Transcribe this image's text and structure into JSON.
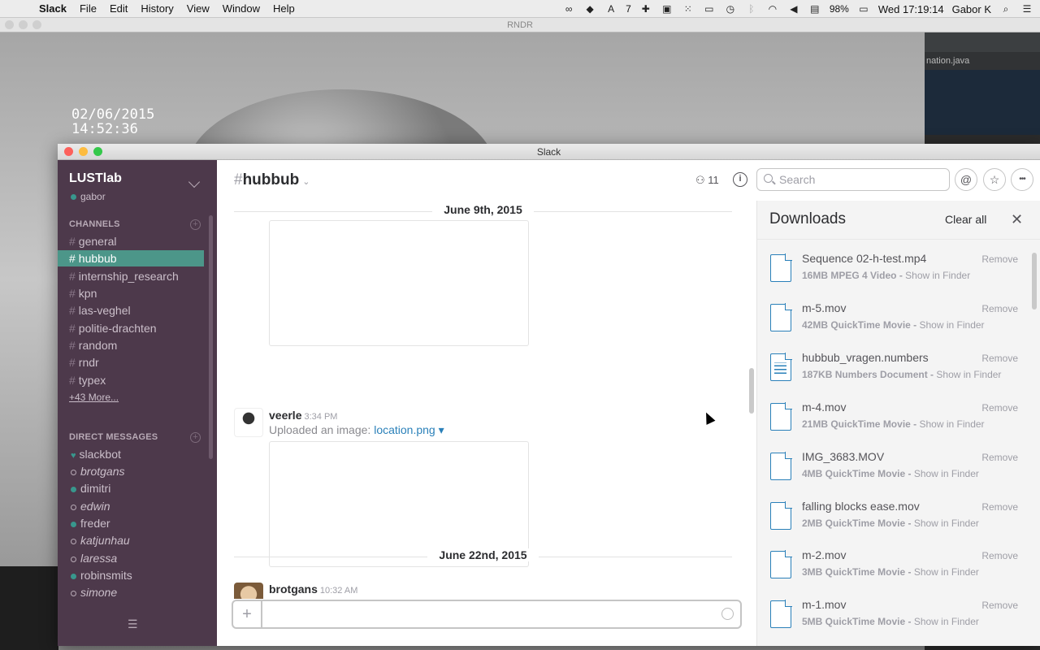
{
  "menubar": {
    "app": "Slack",
    "menus": [
      "File",
      "Edit",
      "History",
      "View",
      "Window",
      "Help"
    ],
    "status": {
      "adobe_count": "7",
      "battery": "98%",
      "clock": "Wed 17:19:14",
      "user": "Gabor K"
    }
  },
  "background_window": {
    "title": "RNDR",
    "overlay_date": "02/06/2015",
    "overlay_time": "14:52:36",
    "ide_tab": "nation.java"
  },
  "window": {
    "title": "Slack"
  },
  "sidebar": {
    "team": "LUSTlab",
    "user": "gabor",
    "channels_header": "CHANNELS",
    "channels": [
      "general",
      "hubbub",
      "internship_research",
      "kpn",
      "las-veghel",
      "politie-drachten",
      "random",
      "rndr",
      "typex"
    ],
    "active_channel": "hubbub",
    "more": "+43 More...",
    "dm_header": "DIRECT MESSAGES",
    "dms": [
      {
        "name": "slackbot",
        "status": "bot"
      },
      {
        "name": "brotgans",
        "status": "away"
      },
      {
        "name": "dimitri",
        "status": "online"
      },
      {
        "name": "edwin",
        "status": "away"
      },
      {
        "name": "freder",
        "status": "online"
      },
      {
        "name": "katjunhau",
        "status": "away"
      },
      {
        "name": "laressa",
        "status": "away"
      },
      {
        "name": "robinsmits",
        "status": "online"
      },
      {
        "name": "simone",
        "status": "away"
      }
    ]
  },
  "header": {
    "hash": "#",
    "channel": "hubbub",
    "member_count": "11",
    "search_placeholder": "Search",
    "at": "@",
    "star": "☆",
    "more": "•••"
  },
  "messages": {
    "day1": "June 9th, 2015",
    "msg1": {
      "user": "veerle",
      "time": "3:34 PM",
      "text_prefix": "Uploaded an image: ",
      "file": "location.png"
    },
    "day2": "June 22nd, 2015",
    "msg2": {
      "user": "brotgans",
      "time": "10:32 AM"
    }
  },
  "composer": {
    "plus": "+"
  },
  "downloads": {
    "title": "Downloads",
    "clear_all": "Clear all",
    "remove_label": "Remove",
    "show_label": "Show in Finder",
    "items": [
      {
        "name": "Sequence 02-h-test.mp4",
        "meta": "16MB MPEG 4 Video -",
        "type": "video"
      },
      {
        "name": "m-5.mov",
        "meta": "42MB QuickTime Movie -",
        "type": "video"
      },
      {
        "name": "hubbub_vragen.numbers",
        "meta": "187KB Numbers Document -",
        "type": "doc"
      },
      {
        "name": "m-4.mov",
        "meta": "21MB QuickTime Movie -",
        "type": "video"
      },
      {
        "name": "IMG_3683.MOV",
        "meta": "4MB QuickTime Movie -",
        "type": "video"
      },
      {
        "name": "falling blocks ease.mov",
        "meta": "2MB QuickTime Movie -",
        "type": "video"
      },
      {
        "name": "m-2.mov",
        "meta": "3MB QuickTime Movie -",
        "type": "video"
      },
      {
        "name": "m-1.mov",
        "meta": "5MB QuickTime Movie -",
        "type": "video"
      }
    ]
  },
  "colors": {
    "sidebar_bg": "#4d394b",
    "active_channel": "#4c9689",
    "link": "#2a80b9",
    "online": "#38978d"
  }
}
